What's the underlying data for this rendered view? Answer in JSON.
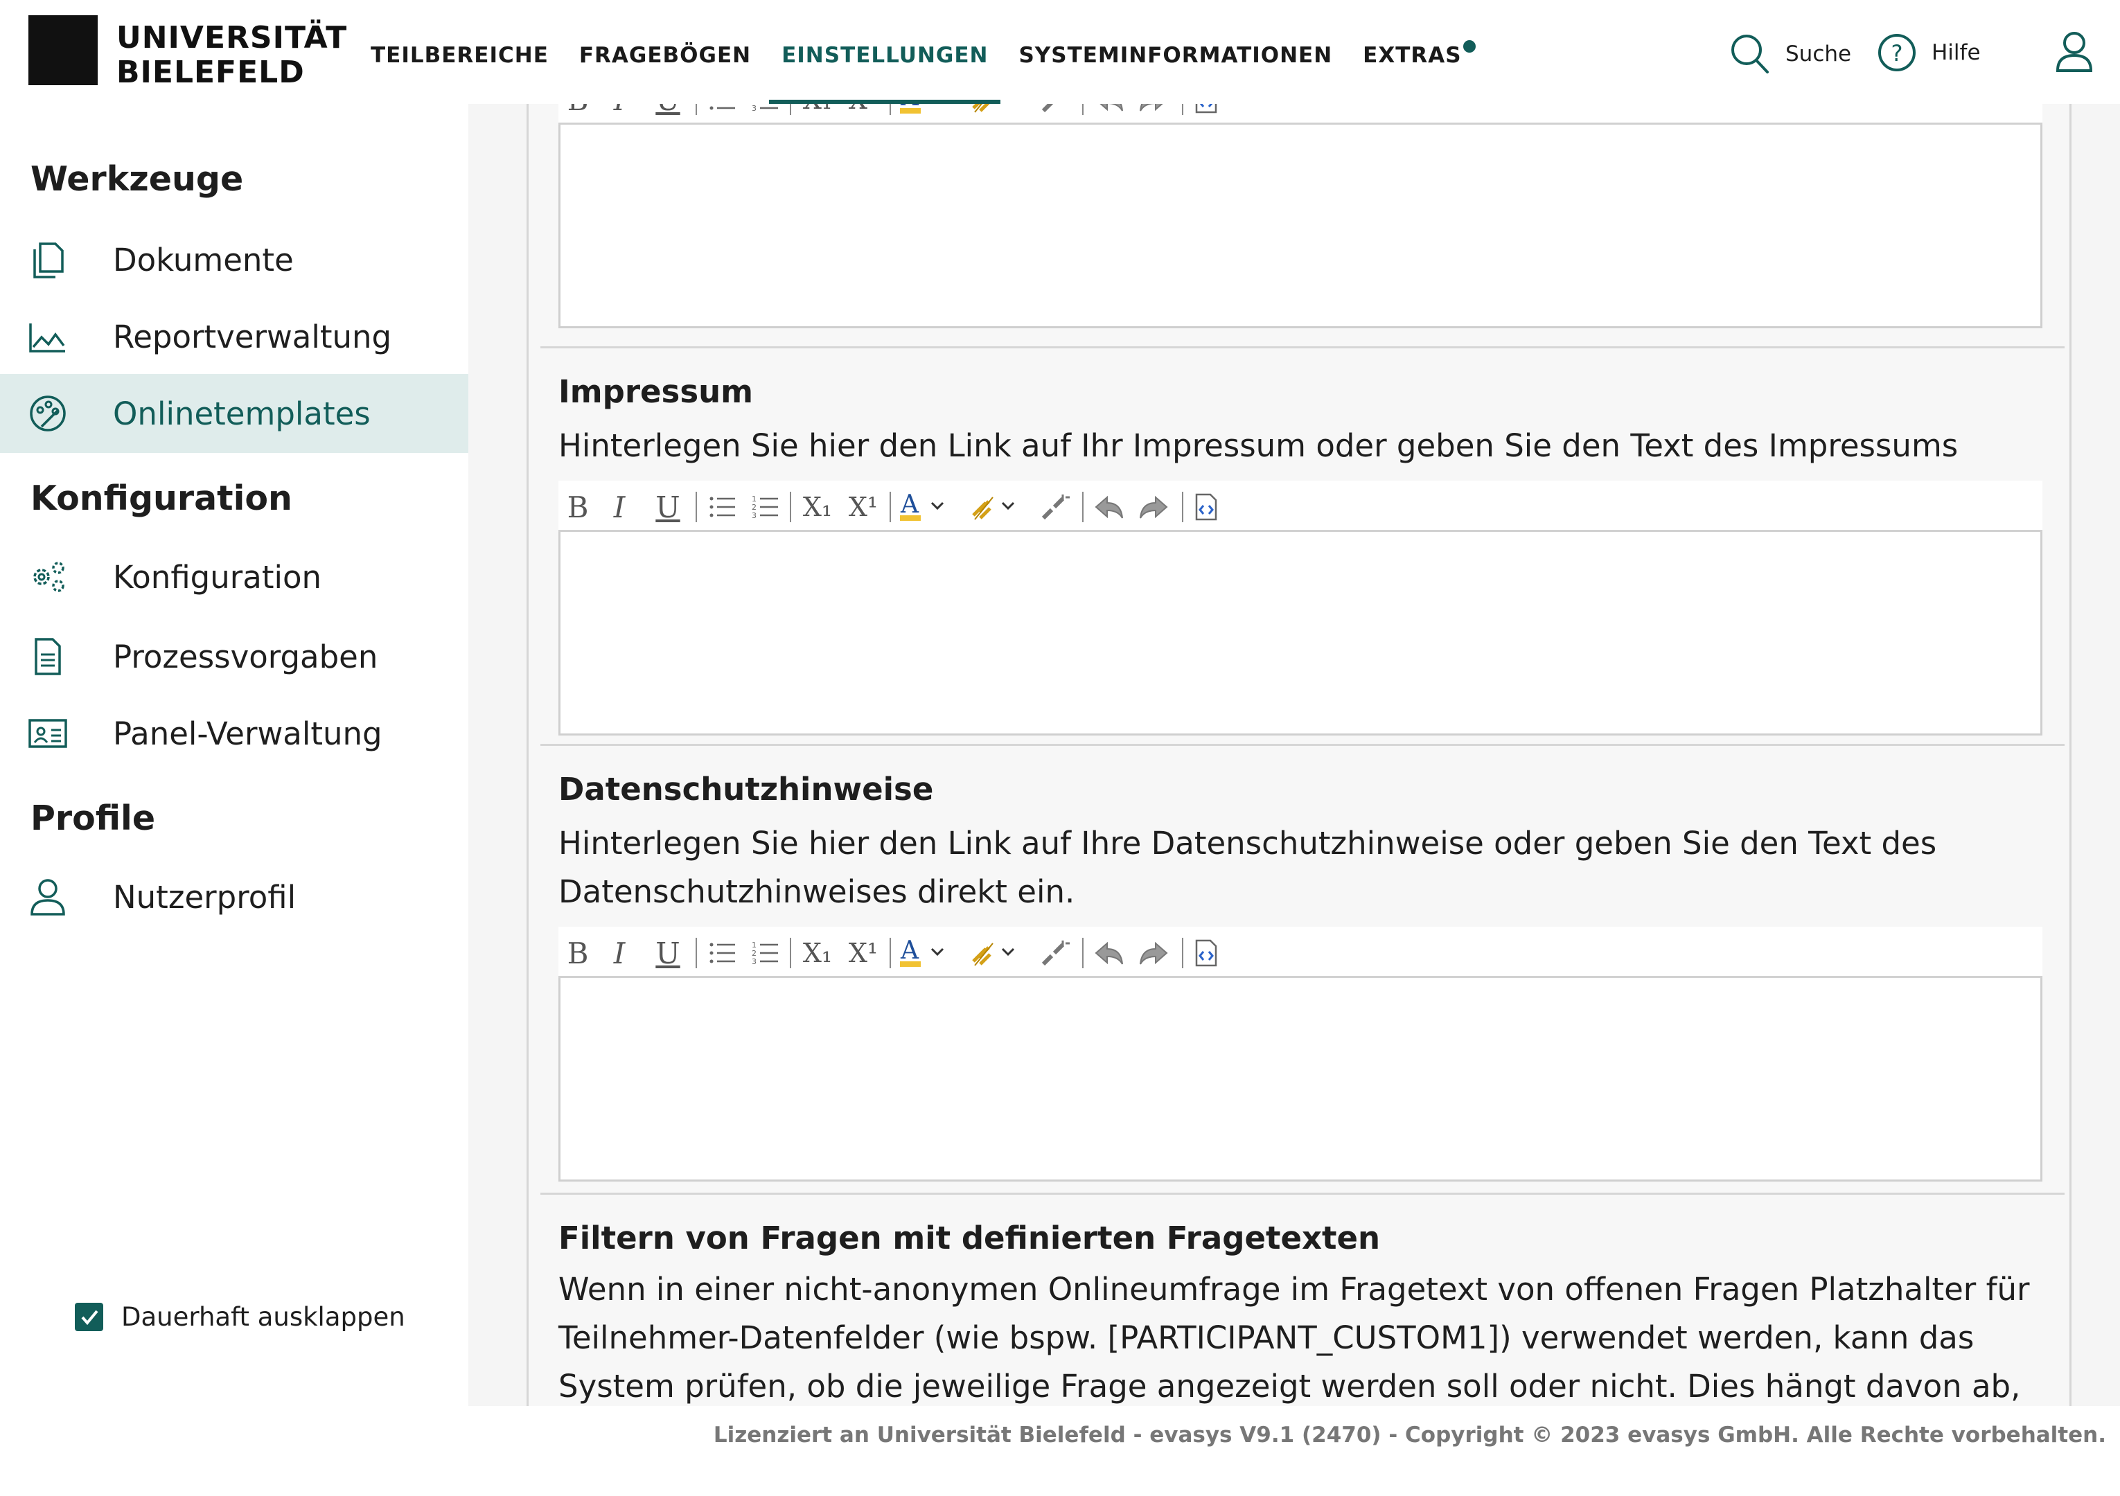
{
  "logo": {
    "line1": "UNIVERSITÄT",
    "line2": "BIELEFELD"
  },
  "nav": [
    {
      "label": "TEILBEREICHE"
    },
    {
      "label": "FRAGEBÖGEN"
    },
    {
      "label": "EINSTELLUNGEN",
      "active": true
    },
    {
      "label": "SYSTEMINFORMATIONEN"
    },
    {
      "label": "EXTRAS",
      "badge": "dot"
    }
  ],
  "header_tools": {
    "search_label": "Suche",
    "help_label": "Hilfe"
  },
  "sidebar": {
    "section1": "Werkzeuge",
    "items1": [
      {
        "label": "Dokumente",
        "icon": "documents-icon"
      },
      {
        "label": "Reportverwaltung",
        "icon": "chart-icon"
      },
      {
        "label": "Onlinetemplates",
        "icon": "palette-icon",
        "active": true
      }
    ],
    "section2": "Konfiguration",
    "items2": [
      {
        "label": "Konfiguration",
        "icon": "gears-icon"
      },
      {
        "label": "Prozessvorgaben",
        "icon": "file-text-icon"
      },
      {
        "label": "Panel-Verwaltung",
        "icon": "id-card-icon"
      }
    ],
    "section3": "Profile",
    "items3": [
      {
        "label": "Nutzerprofil",
        "icon": "user-icon"
      }
    ],
    "persist_checkbox": {
      "label": "Dauerhaft ausklappen",
      "checked": true
    }
  },
  "sections": [
    {
      "title": "Impressum",
      "description": "Hinterlegen Sie hier den Link auf Ihr Impressum oder geben Sie den Text des Impressums direkt ein."
    },
    {
      "title": "Datenschutzhinweise",
      "description": "Hinterlegen Sie hier den Link auf Ihre Datenschutzhinweise oder geben Sie den Text des Datenschutzhinweises direkt ein."
    },
    {
      "title": "Filtern von Fragen mit definierten Fragetexten",
      "description": "Wenn in einer nicht-anonymen Onlineumfrage im Fragetext von offenen Fragen Platzhalter für Teilnehmer-Datenfelder (wie bspw. [PARTICIPANT_CUSTOM1]) verwendet werden, kann das System prüfen, ob die jeweilige Frage angezeigt werden soll oder nicht. Dies hängt davon ab, ob in den"
    }
  ],
  "toolbar_labels": {
    "bold": "B",
    "italic": "I",
    "underline": "U",
    "subscript": "X₁",
    "superscript": "X¹"
  },
  "footer": {
    "text": "Lizenziert an Universität Bielefeld - evasys V9.1 (2470) - Copyright © 2023 evasys GmbH. Alle Rechte vorbehalten."
  },
  "colors": {
    "accent": "#125d59",
    "active_bg": "#dfeceb"
  }
}
